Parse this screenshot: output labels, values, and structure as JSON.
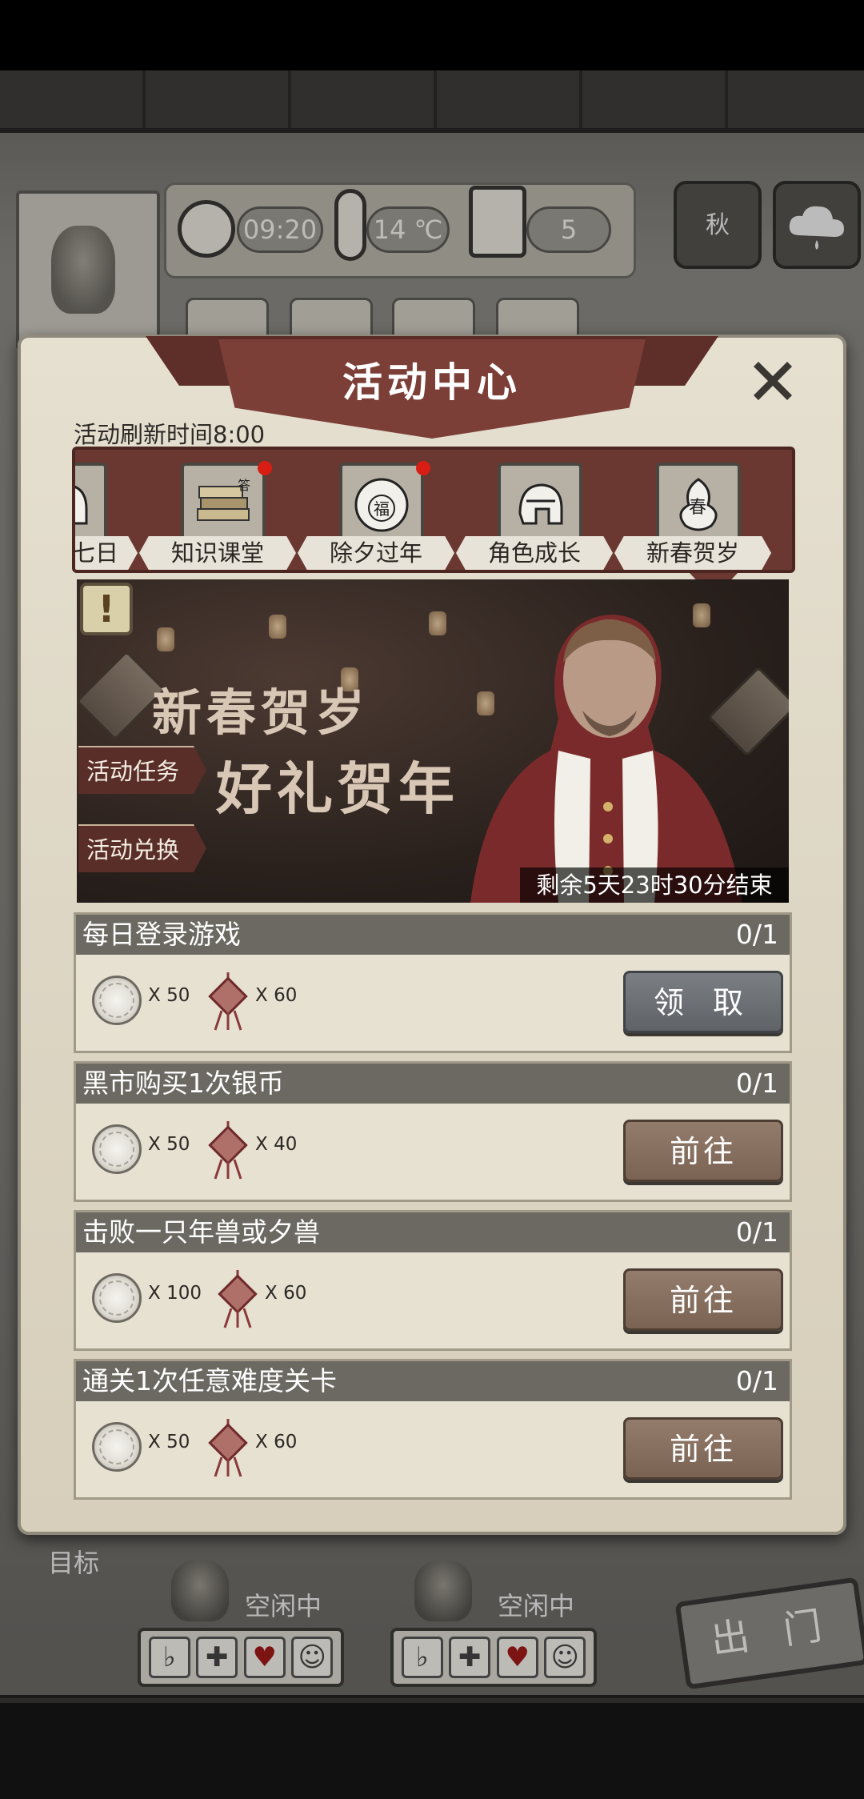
{
  "hud": {
    "time": "09:20",
    "temperature": "14 ℃",
    "day": "5",
    "season": "秋",
    "weather_icon": "rain-cloud-icon",
    "objective_label": "目标",
    "go_out_label": "出 门"
  },
  "characters": [
    {
      "status": "空闲中"
    },
    {
      "status": "空闲中"
    }
  ],
  "panel": {
    "title": "活动中心",
    "refresh_time": "活动刷新时间8:00"
  },
  "tabs": [
    {
      "label": "七日",
      "icon": "helmet-icon",
      "badge": false
    },
    {
      "label": "知识课堂",
      "icon": "books-icon",
      "badge": true
    },
    {
      "label": "除夕过年",
      "icon": "fu-emblem-icon",
      "badge": true
    },
    {
      "label": "角色成长",
      "icon": "helmet-icon",
      "badge": false
    },
    {
      "label": "新春贺岁",
      "icon": "spring-knot-icon",
      "badge": false,
      "selected": true
    }
  ],
  "banner": {
    "warning": "!",
    "title_line1": "新春贺岁",
    "title_line2": "好礼贺年",
    "task_button": "活动任务",
    "exchange_button": "活动兑换",
    "countdown": "剩余5天23时30分结束"
  },
  "tasks": [
    {
      "name": "每日登录游戏",
      "progress": "0/1",
      "coin_qty": "X 50",
      "knot_qty": "X 60",
      "action": "领 取",
      "action_type": "claim"
    },
    {
      "name": "黑市购买1次银币",
      "progress": "0/1",
      "coin_qty": "X 50",
      "knot_qty": "X 40",
      "action": "前往",
      "action_type": "go"
    },
    {
      "name": "击败一只年兽或夕兽",
      "progress": "0/1",
      "coin_qty": "X 100",
      "knot_qty": "X 60",
      "action": "前往",
      "action_type": "go"
    },
    {
      "name": "通关1次任意难度关卡",
      "progress": "0/1",
      "coin_qty": "X 50",
      "knot_qty": "X 60",
      "action": "前往",
      "action_type": "go"
    }
  ],
  "colors": {
    "ribbon": "#7b3f37",
    "tab_strip": "#6b3831",
    "task_header": "#6c6963",
    "badge_red": "#d81e14"
  }
}
